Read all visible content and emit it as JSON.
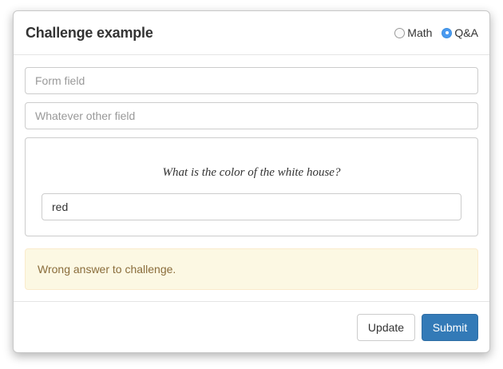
{
  "modal": {
    "title": "Challenge example",
    "challenge_types": [
      {
        "label": "Math",
        "checked": false
      },
      {
        "label": "Q&A",
        "checked": true
      }
    ]
  },
  "form": {
    "field1_placeholder": "Form field",
    "field2_placeholder": "Whatever other field",
    "challenge": {
      "question": "What is the color of the white house?",
      "answer_value": "red"
    },
    "alert_text": "Wrong answer to challenge."
  },
  "footer": {
    "update_label": "Update",
    "submit_label": "Submit"
  },
  "colors": {
    "primary": "#337ab7",
    "warning_bg": "#fcf8e3",
    "warning_text": "#8a6d3b",
    "radio_checked": "#4a9af0"
  }
}
